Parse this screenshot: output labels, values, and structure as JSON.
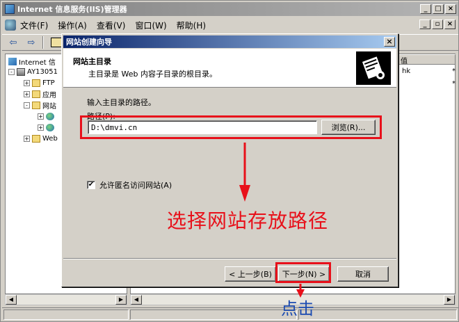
{
  "main_window": {
    "title": "Internet 信息服务(IIS)管理器",
    "title_buttons": [
      "_",
      "□",
      "×"
    ],
    "inner_buttons": [
      "_",
      "▫",
      "×"
    ],
    "menus": [
      "文件(F)",
      "操作(A)",
      "查看(V)",
      "窗口(W)",
      "帮助(H)"
    ]
  },
  "tree": {
    "items": [
      {
        "label": "Internet 信",
        "toggle": ""
      },
      {
        "label": "AY13051",
        "toggle": "-"
      },
      {
        "label": "FTP",
        "toggle": "+"
      },
      {
        "label": "应用",
        "toggle": "+"
      },
      {
        "label": "网站",
        "toggle": "-"
      },
      {
        "label": "",
        "toggle": "+"
      },
      {
        "label": "",
        "toggle": "+"
      },
      {
        "label": "Web",
        "toggle": "+"
      }
    ]
  },
  "list": {
    "header": "值",
    "cell": "hk",
    "star1": "*",
    "star2": "*"
  },
  "dialog": {
    "title": "网站创建向导",
    "close": "×",
    "header_title": "网站主目录",
    "header_subtitle": "主目录是 Web 内容子目录的根目录。",
    "prompt": "输入主目录的路径。",
    "path_label": "路径(P):",
    "path_value": "D:\\dmvi.cn",
    "browse_button": "浏览(R)...",
    "checkbox_label": "允许匿名访问网站(A)",
    "checkbox_checked": true,
    "back_button": "< 上一步(B)",
    "next_button": "下一步(N) >",
    "cancel_button": "取消"
  },
  "annotations": {
    "instruction": "选择网站存放路径",
    "click_hint": "点击",
    "color": "#e8101a"
  }
}
